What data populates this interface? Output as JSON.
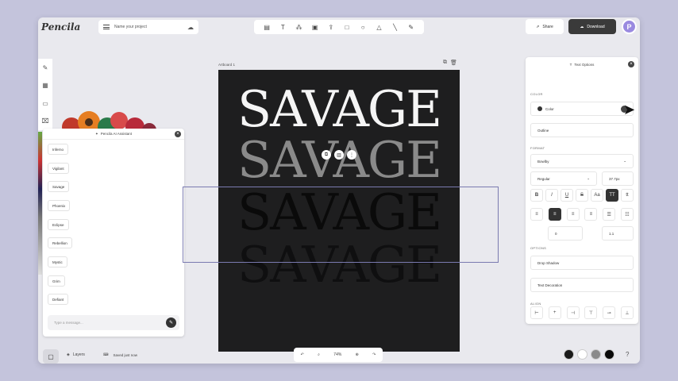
{
  "app": {
    "logo": "Pencila",
    "project_name": "Name your project"
  },
  "toolbar": {
    "tools": [
      "layout-icon",
      "text-icon",
      "shapes-icon",
      "image-icon",
      "upload-icon",
      "rect-icon",
      "circle-icon",
      "triangle-icon",
      "line-icon",
      "pen-icon"
    ]
  },
  "header": {
    "share": "Share",
    "download": "Download",
    "avatar": "P"
  },
  "assistant": {
    "title": "Pencila AI Assistant",
    "suggestions": [
      "Inferno",
      "Vigilant",
      "Savage",
      "Phoenix",
      "Eclipse",
      "Rebellion",
      "Mystic",
      "Grim",
      "Defiant"
    ],
    "message_placeholder": "Type a message..."
  },
  "artboard": {
    "label": "Artboard 1",
    "words": [
      "SAVAGE",
      "SAVAGE",
      "SAVAGE",
      "SAVAGE"
    ]
  },
  "text_options": {
    "title": "Text Options",
    "color_section": "COLOR",
    "color_label": "Color",
    "outline_label": "Outline",
    "format_section": "FORMAT",
    "font": "Bowlby",
    "weight": "Regular",
    "size": "37.7px",
    "letter_spacing": "0",
    "line_height": "1.1",
    "options_section": "OPTIONS",
    "drop_shadow": "Drop Shadow",
    "text_decoration": "Text Decoration",
    "align_section": "ALIGN"
  },
  "footer": {
    "layers": "Layers",
    "saved": "Saved just now",
    "zoom": "74%"
  }
}
